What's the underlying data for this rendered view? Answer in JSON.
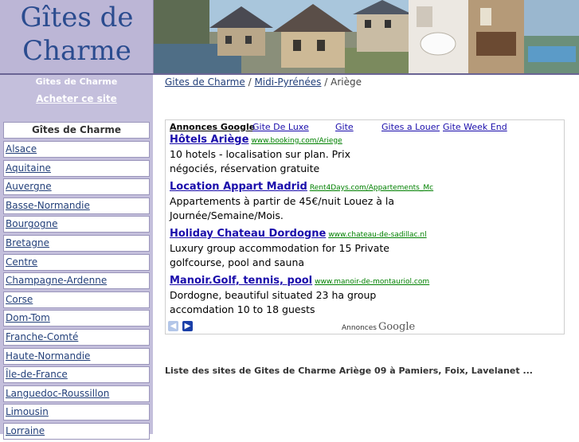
{
  "logo": {
    "line1": "Gîtes de",
    "line2": "Charme"
  },
  "sidebar": {
    "title": "Gites de Charme",
    "buy_link": "Acheter ce site",
    "list_heading": "Gîtes de Charme",
    "items": [
      {
        "label": "Alsace"
      },
      {
        "label": "Aquitaine"
      },
      {
        "label": "Auvergne"
      },
      {
        "label": "Basse-Normandie"
      },
      {
        "label": "Bourgogne"
      },
      {
        "label": "Bretagne"
      },
      {
        "label": "Centre"
      },
      {
        "label": "Champagne-Ardenne"
      },
      {
        "label": "Corse"
      },
      {
        "label": "Dom-Tom"
      },
      {
        "label": "Franche-Comté"
      },
      {
        "label": "Haute-Normandie"
      },
      {
        "label": "Île-de-France"
      },
      {
        "label": "Languedoc-Roussillon"
      },
      {
        "label": "Limousin"
      },
      {
        "label": "Lorraine"
      }
    ]
  },
  "breadcrumb": {
    "item1": "Gites de Charme",
    "sep": "/",
    "item2": "Midi-Pyrénées",
    "current": "Ariège"
  },
  "ads": {
    "label": "Annonces Google",
    "top_links": [
      "Gite De Luxe",
      "Gite",
      "Gites a Louer",
      "Gite Week End"
    ],
    "items": [
      {
        "title": "Hôtels Ariège",
        "url": "www.booking.com/Ariege",
        "desc": "10 hotels - localisation sur plan. Prix négociés, réservation gratuite"
      },
      {
        "title": "Location Appart Madrid",
        "url": "Rent4Days.com/Appartements_Mc",
        "desc": "Appartements à partir de 45€/nuit Louez à la Journée/Semaine/Mois."
      },
      {
        "title": "Holiday Chateau Dordogne",
        "url": "www.chateau-de-sadillac.nl",
        "desc": "Luxury group accommodation for 15 Private golfcourse, pool and sauna"
      },
      {
        "title": "Manoir.Golf, tennis, pool",
        "url": "www.manoir-de-montauriol.com",
        "desc": "Dordogne, beautiful situated 23 ha group accomdation 10 to 18 guests"
      }
    ],
    "footer_label": "Annonces",
    "footer_brand": "Google",
    "prev_icon": "chevron-left-icon",
    "next_icon": "chevron-right-icon"
  },
  "intro": "Liste des sites de Gites de Charme Ariège 09 à Pamiers, Foix, Lavelanet ..."
}
